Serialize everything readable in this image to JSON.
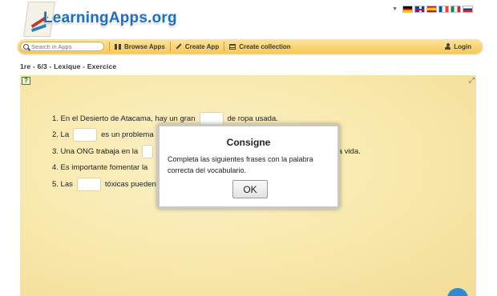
{
  "header": {
    "logo_text": "LearningApps.org",
    "language_flags": [
      "de",
      "gb",
      "es",
      "fr",
      "it",
      "ru"
    ]
  },
  "toolbar": {
    "search_placeholder": "Search in Apps",
    "browse_label": "Browse Apps",
    "create_label": "Create App",
    "collection_label": "Create collection",
    "login_label": "Login"
  },
  "breadcrumb": "1re - 6/3 - Lexique - Exercice",
  "exercise": {
    "sentences": [
      {
        "pre": "1. En el Desierto de Atacama, hay un gran",
        "post": "de ropa usada."
      },
      {
        "pre": "2. La",
        "post": "es un problema"
      },
      {
        "pre": "3. Una ONG trabaja en la",
        "post": "nda vida."
      },
      {
        "pre": "4. Es importante fomentar la",
        "post": ""
      },
      {
        "pre": "5. Las",
        "post": "tóxicas pueden"
      }
    ]
  },
  "modal": {
    "title": "Consigne",
    "text": "Completa las siguientes frases con la palabra correcta del vocabulario.",
    "ok_label": "OK"
  },
  "colors": {
    "brand_blue": "#1f6fc0",
    "toolbar_yellow": "#f6c85a",
    "stage_bg": "#f8e8aa"
  }
}
